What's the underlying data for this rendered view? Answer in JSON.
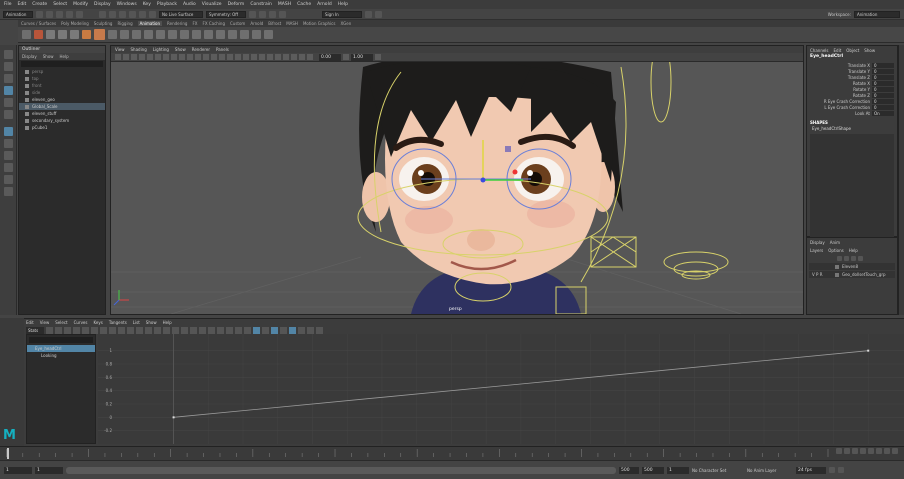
{
  "app": {
    "menus": [
      "File",
      "Edit",
      "Create",
      "Select",
      "Modify",
      "Display",
      "Windows",
      "Key",
      "Playback",
      "Audio",
      "Visualize",
      "Deform",
      "Constrain",
      "MASH",
      "Cache",
      "Arnold",
      "Help"
    ],
    "mode_dropdown": "Animation",
    "surface_dropdown": "No Live Surface",
    "symmetry_dropdown": "Symmetry: Off",
    "sign_in": "Sign In",
    "workspace_label": "Workspace:",
    "workspace_value": "Animation"
  },
  "shelf_tabs": [
    "Curves / Surfaces",
    "Poly Modeling",
    "Sculpting",
    "Rigging",
    "Animation",
    "Rendering",
    "FX",
    "FX Caching",
    "Custom",
    "Arnold",
    "Bifrost",
    "MASH",
    "Motion Graphics",
    "XGen"
  ],
  "shelf_active": "Animation",
  "outliner": {
    "title": "Outliner",
    "menu": [
      "Display",
      "Show",
      "Help"
    ],
    "items": [
      {
        "label": "persp",
        "dim": true
      },
      {
        "label": "top",
        "dim": true
      },
      {
        "label": "front",
        "dim": true
      },
      {
        "label": "side",
        "dim": true
      },
      {
        "label": "eleven_geo",
        "dim": false
      },
      {
        "label": "Global_Scale",
        "dim": false,
        "selected": true
      },
      {
        "label": "eleven_stuff",
        "dim": false
      },
      {
        "label": "secondary_system",
        "dim": false
      },
      {
        "label": "pCube1",
        "dim": false
      }
    ]
  },
  "viewport": {
    "menu": [
      "View",
      "Shading",
      "Lighting",
      "Show",
      "Renderer",
      "Panels"
    ],
    "camera_label": "persp",
    "field1": "0.00",
    "field2": "1.00",
    "colors": {
      "bg": "#565656",
      "grid": "#5f5f5f",
      "ctrl": "#d8d26a",
      "ctrl_blue": "#6a7fd8"
    }
  },
  "channel_box": {
    "tabs": [
      "Channels",
      "Edit",
      "Object",
      "Show"
    ],
    "object_name": "Eye_headCtrl",
    "channels": [
      {
        "label": "Translate X",
        "value": "0"
      },
      {
        "label": "Translate Y",
        "value": "0"
      },
      {
        "label": "Translate Z",
        "value": "0"
      },
      {
        "label": "Rotate X",
        "value": "0"
      },
      {
        "label": "Rotate Y",
        "value": "0"
      },
      {
        "label": "Rotate Z",
        "value": "0"
      },
      {
        "label": "R Eye Crash Correction",
        "value": "0"
      },
      {
        "label": "L Eye Crash Correction",
        "value": "0"
      },
      {
        "label": "Look At",
        "value": "On"
      }
    ],
    "shapes_header": "SHAPES",
    "shape_name": "Eye_headCtrlShape"
  },
  "layers": {
    "tabs": [
      "Display",
      "Anim"
    ],
    "menu": [
      "Layers",
      "Options",
      "Help"
    ],
    "items": [
      {
        "flags": "",
        "name": "Eleven8"
      },
      {
        "flags": "V  P  R",
        "name": "Geo_dollsetTouch_grp"
      }
    ]
  },
  "graph_editor": {
    "menu": [
      "Edit",
      "View",
      "Select",
      "Curves",
      "Keys",
      "Tangents",
      "List",
      "Show",
      "Help"
    ],
    "stats_label": "Stats",
    "outliner_items": [
      {
        "label": "Eye_headCtrl",
        "selected": true
      },
      {
        "label": "Looking",
        "selected": false
      }
    ],
    "y_ticks": [
      "1",
      "0.8",
      "0.6",
      "0.4",
      "0.2",
      "0",
      "-0.2"
    ],
    "curve": {
      "x": [
        0,
        500
      ],
      "y": [
        0,
        1
      ],
      "xlim": [
        -40,
        520
      ],
      "ylim": [
        -0.25,
        1.1
      ]
    }
  },
  "timeline": {
    "range_start": "1",
    "range_start2": "1",
    "range_end": "500",
    "range_end2": "500",
    "current_frame": "1",
    "character_set": "No Character Set",
    "anim_layer": "No Anim Layer",
    "fps": "24 fps"
  },
  "brand": "M"
}
